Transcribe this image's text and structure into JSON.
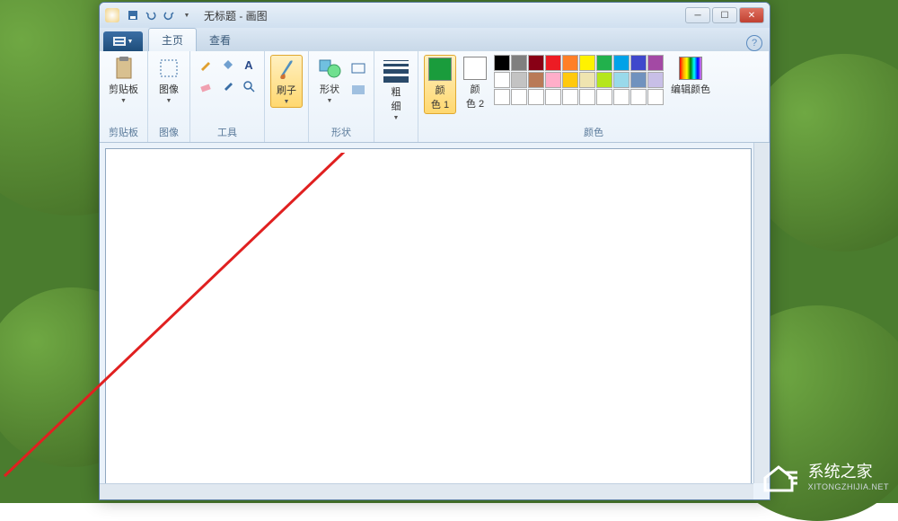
{
  "window": {
    "title": "无标题 - 画图"
  },
  "tabs": {
    "home": "主页",
    "view": "查看"
  },
  "groups": {
    "clipboard": {
      "label": "剪贴板",
      "paste": "剪贴板"
    },
    "image": {
      "label": "图像",
      "select": "图像"
    },
    "tools": {
      "label": "工具"
    },
    "brushes": {
      "label": "刷子",
      "btn": "刷子"
    },
    "shapes": {
      "label": "形状",
      "btn": "形状"
    },
    "size": {
      "label": "粗\n细"
    },
    "colors": {
      "label": "颜色",
      "color1": "颜\n色 1",
      "color2": "颜\n色 2",
      "edit": "编辑颜色"
    }
  },
  "active_color": "#1a9c3c",
  "color2_color": "#ffffff",
  "palette": [
    "#000000",
    "#7f7f7f",
    "#880015",
    "#ed1c24",
    "#ff7f27",
    "#fff200",
    "#22b14c",
    "#00a2e8",
    "#3f48cc",
    "#a349a4",
    "#ffffff",
    "#c3c3c3",
    "#b97a57",
    "#ffaec9",
    "#ffc90e",
    "#efe4b0",
    "#b5e61d",
    "#99d9ea",
    "#7092be",
    "#c8bfe7",
    "#ffffff",
    "#ffffff",
    "#ffffff",
    "#ffffff",
    "#ffffff",
    "#ffffff",
    "#ffffff",
    "#ffffff",
    "#ffffff",
    "#ffffff"
  ],
  "watermark": {
    "text": "系统之家",
    "sub": "XITONGZHIJIA.NET"
  }
}
